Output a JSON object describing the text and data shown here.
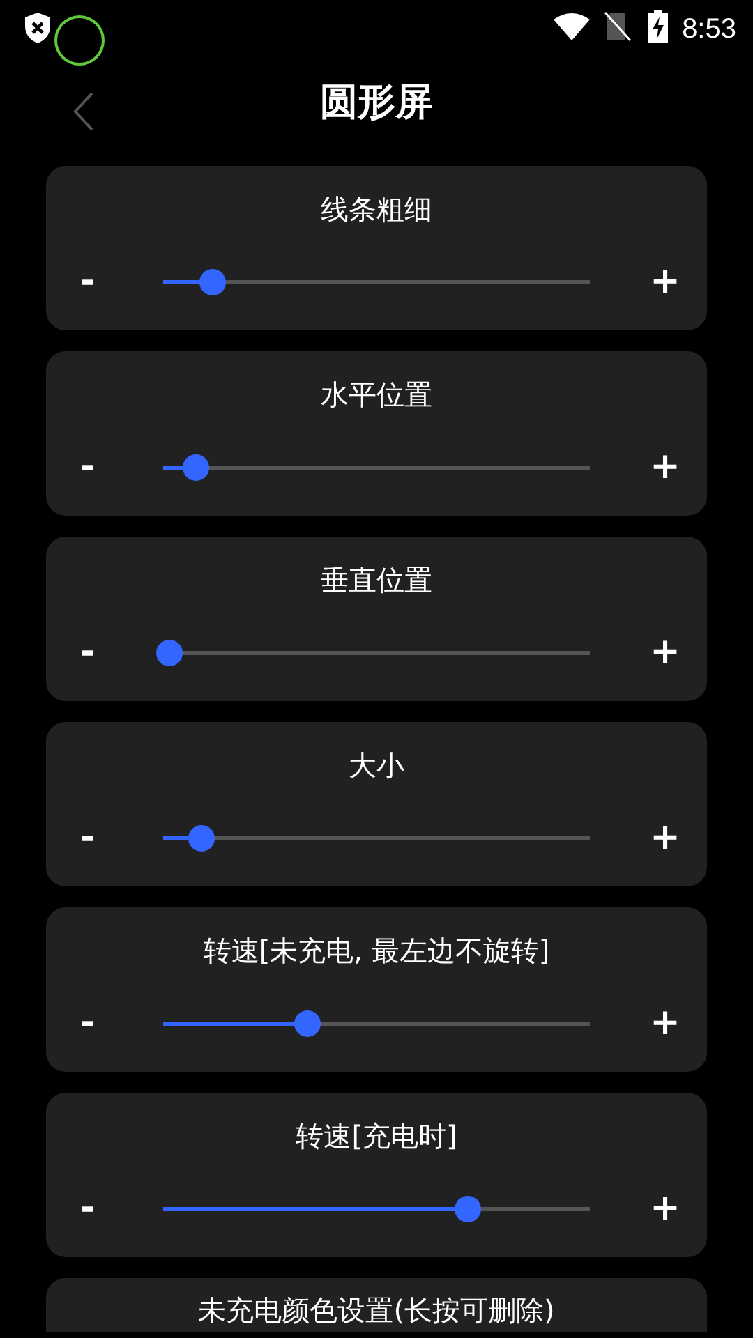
{
  "status_bar": {
    "time": "8:53"
  },
  "header": {
    "title": "圆形屏"
  },
  "settings": [
    {
      "kind": "slider",
      "label": "线条粗细",
      "minus": "-",
      "plus": "+",
      "level": 0.114
    },
    {
      "kind": "slider",
      "label": "水平位置",
      "minus": "-",
      "plus": "+",
      "level": 0.075
    },
    {
      "kind": "slider",
      "label": "垂直位置",
      "minus": "-",
      "plus": "+",
      "level": 0.013
    },
    {
      "kind": "slider",
      "label": "大小",
      "minus": "-",
      "plus": "+",
      "level": 0.088
    },
    {
      "kind": "slider",
      "label": "转速[未充电, 最左边不旋转]",
      "minus": "-",
      "plus": "+",
      "level": 0.337
    },
    {
      "kind": "slider",
      "label": "转速[充电时]",
      "minus": "-",
      "plus": "+",
      "level": 0.712
    },
    {
      "kind": "heading",
      "label": "未充电颜色设置(长按可删除)"
    }
  ]
}
